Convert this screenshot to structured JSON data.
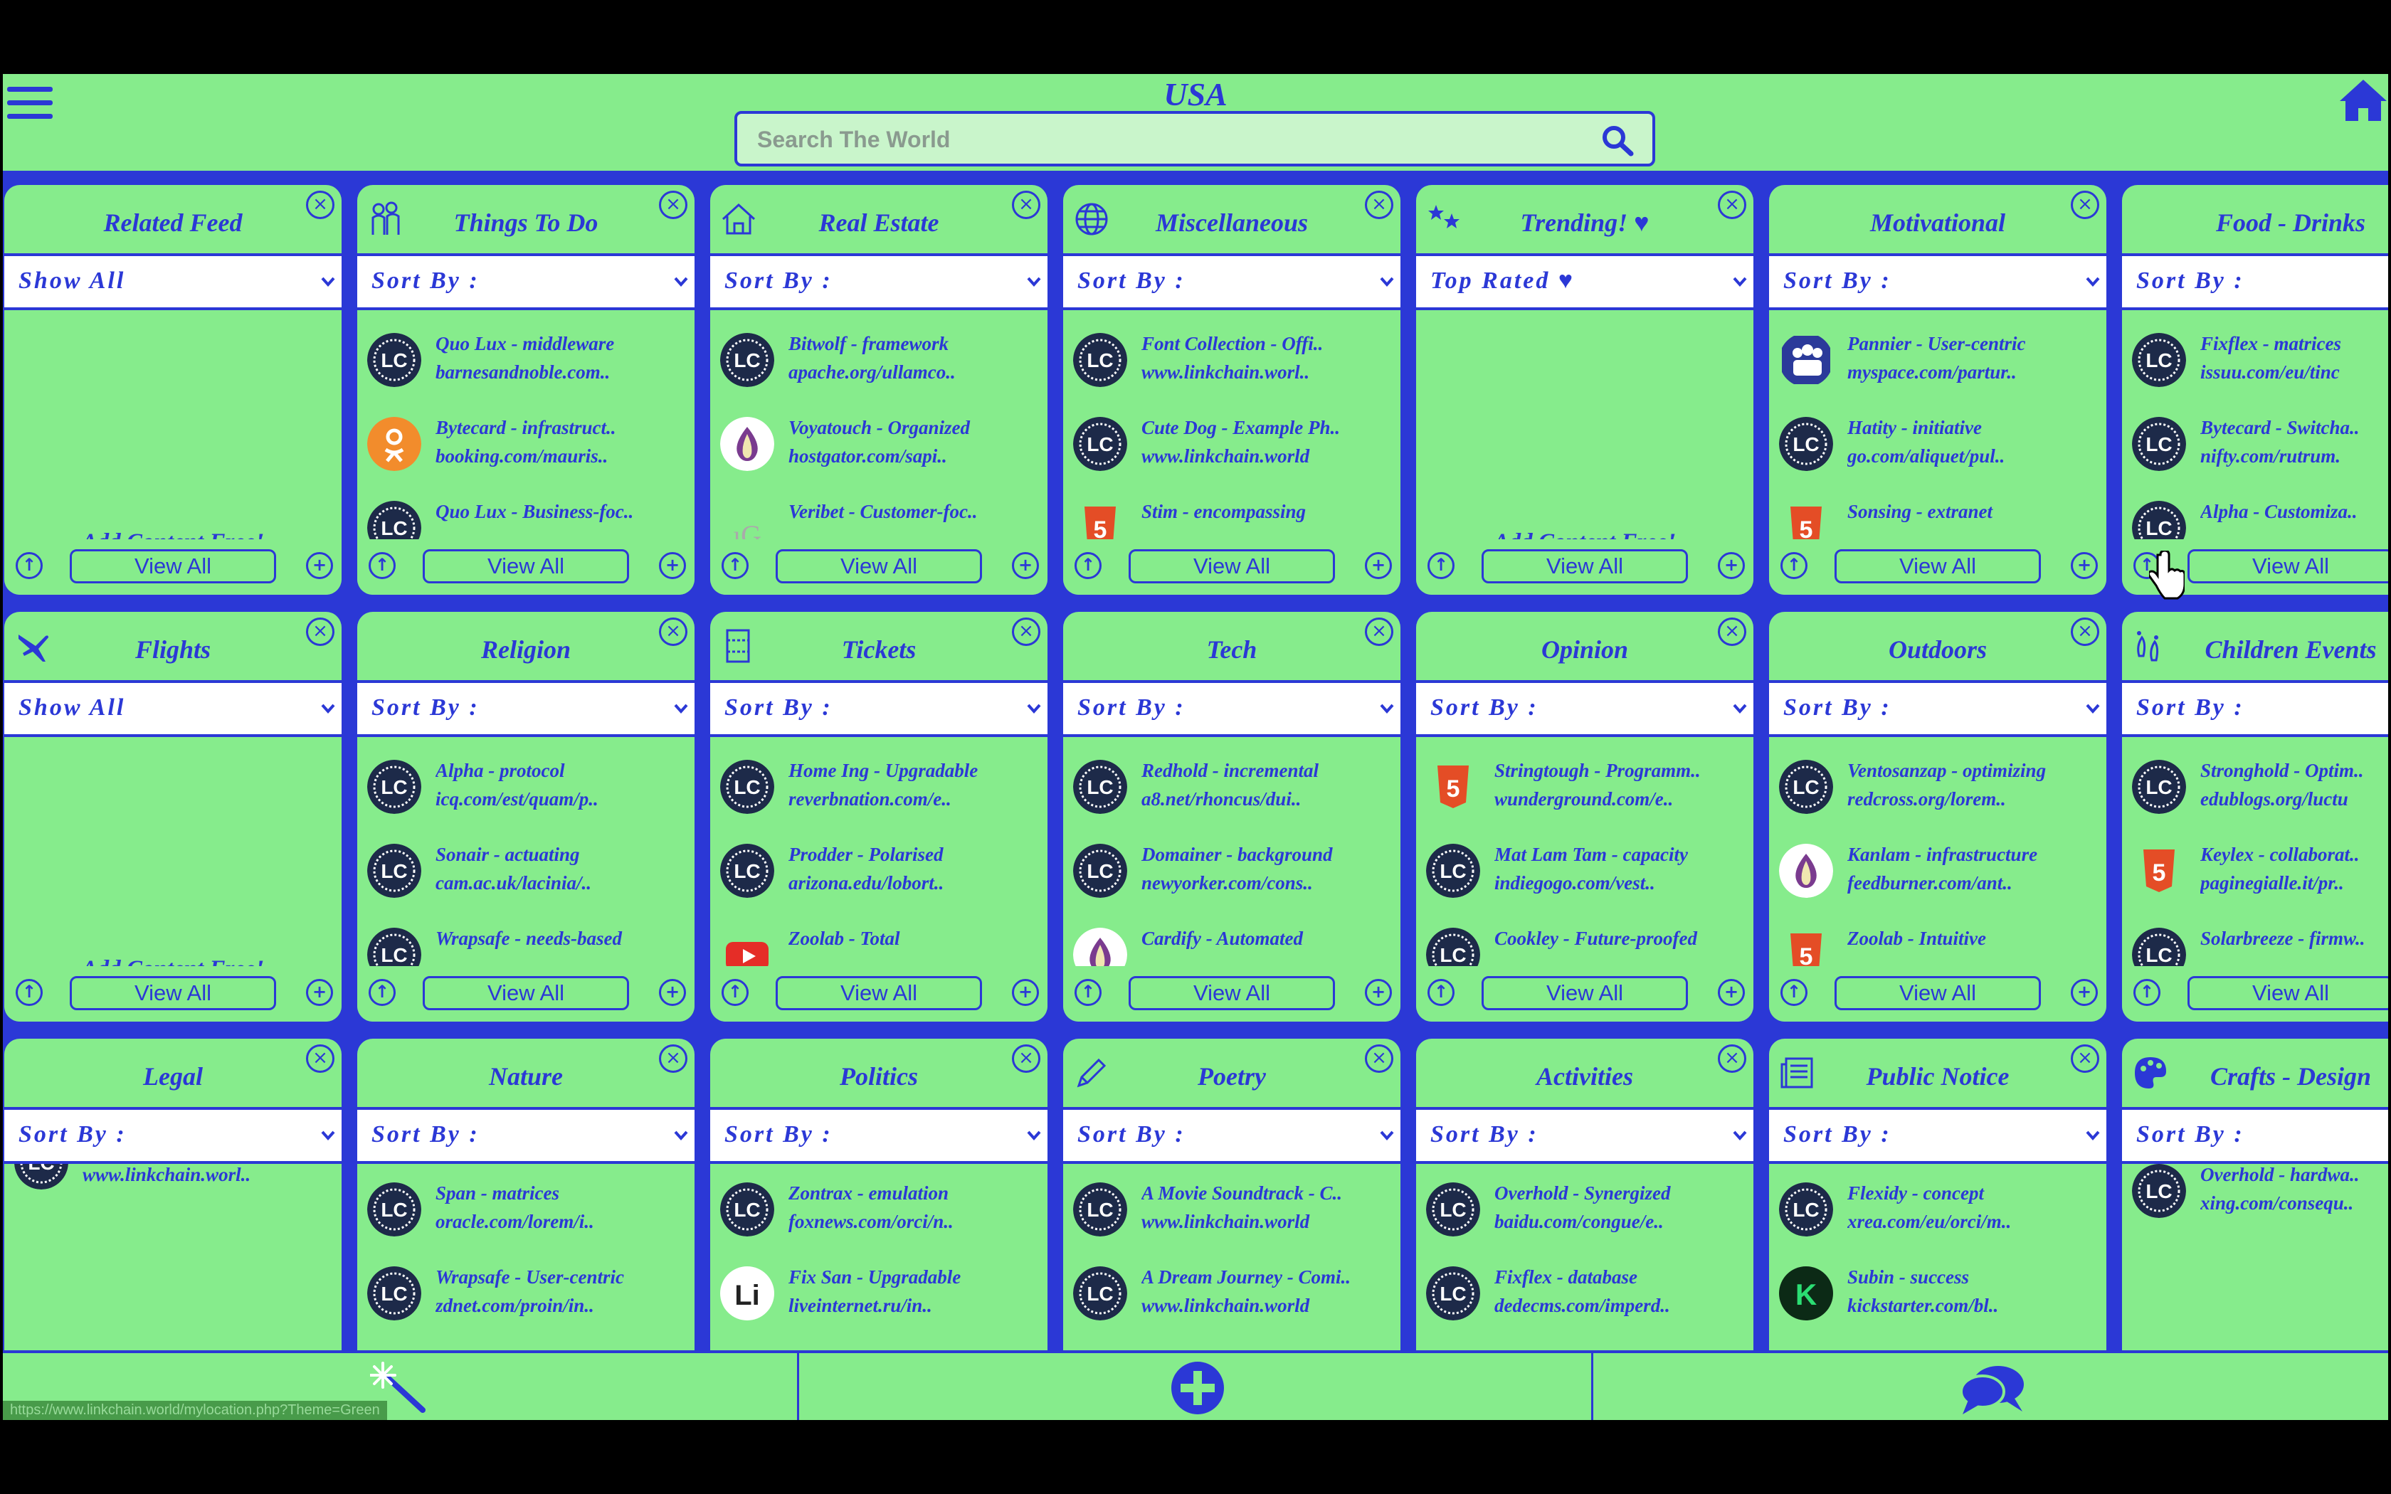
{
  "header": {
    "title": "USA",
    "search_placeholder": "Search The World"
  },
  "footer": {
    "status_url": "https://www.linkchain.world/mylocation.php?Theme=Green"
  },
  "colors": {
    "accent": "#2b38d6",
    "panel": "#86ec8c"
  },
  "cards": [
    {
      "title": "Related Feed",
      "icon": "",
      "sort": "Show All",
      "empty": true,
      "add_content": "Add Content Free!",
      "view_all": "View All",
      "items": []
    },
    {
      "title": "Things To Do",
      "icon": "activities-icon",
      "sort": "Sort By :",
      "view_all": "View All",
      "items": [
        {
          "icon": "lc",
          "title": "Quo Lux - middleware",
          "url": "barnesandnoble.com.."
        },
        {
          "icon": "ok",
          "title": "Bytecard - infrastruct..",
          "url": "booking.com/mauris.."
        },
        {
          "icon": "lc",
          "title": "Quo Lux - Business-foc..",
          "url": ""
        }
      ]
    },
    {
      "title": "Real Estate",
      "icon": "house-icon",
      "sort": "Sort By :",
      "view_all": "View All",
      "items": [
        {
          "icon": "lc",
          "title": "Bitwolf - framework",
          "url": "apache.org/ullamco.."
        },
        {
          "icon": "tor",
          "title": "Voyatouch - Organized",
          "url": "hostgator.com/sapi.."
        },
        {
          "icon": "ig",
          "title": "Veribet - Customer-foc..",
          "url": ""
        }
      ]
    },
    {
      "title": "Miscellaneous",
      "icon": "globe-icon",
      "sort": "Sort By :",
      "view_all": "View All",
      "items": [
        {
          "icon": "lc",
          "title": "Font Collection - Offi..",
          "url": "www.linkchain.worl.."
        },
        {
          "icon": "lc",
          "title": "Cute Dog - Example Ph..",
          "url": "www.linkchain.world"
        },
        {
          "icon": "html5",
          "title": "Stim - encompassing",
          "url": ""
        }
      ]
    },
    {
      "title": "Trending! ♥",
      "icon": "stars-icon",
      "sort": "Top Rated ♥",
      "empty": true,
      "add_content": "Add Content Free!",
      "view_all": "View All",
      "items": []
    },
    {
      "title": "Motivational",
      "icon": "",
      "sort": "Sort By :",
      "view_all": "View All",
      "items": [
        {
          "icon": "myspace",
          "title": "Pannier - User-centric",
          "url": "myspace.com/partur.."
        },
        {
          "icon": "lc",
          "title": "Hatity - initiative",
          "url": "go.com/aliquet/pul.."
        },
        {
          "icon": "html5",
          "title": "Sonsing - extranet",
          "url": ""
        }
      ]
    },
    {
      "title": "Food - Drinks",
      "icon": "",
      "sort": "Sort By :",
      "view_all": "View All",
      "items": [
        {
          "icon": "lc",
          "title": "Fixflex - matrices",
          "url": "issuu.com/eu/tinc"
        },
        {
          "icon": "lc",
          "title": "Bytecard - Switcha..",
          "url": "nifty.com/rutrum."
        },
        {
          "icon": "lc",
          "title": "Alpha - Customiza..",
          "url": ""
        }
      ]
    },
    {
      "title": "Flights",
      "icon": "plane-icon",
      "sort": "Show All",
      "empty": true,
      "add_content": "Add Content Free!",
      "view_all": "View All",
      "items": []
    },
    {
      "title": "Religion",
      "icon": "",
      "sort": "Sort By :",
      "view_all": "View All",
      "items": [
        {
          "icon": "lc",
          "title": "Alpha - protocol",
          "url": "icq.com/est/quam/p.."
        },
        {
          "icon": "lc",
          "title": "Sonair - actuating",
          "url": "cam.ac.uk/lacinia/.."
        },
        {
          "icon": "lc",
          "title": "Wrapsafe - needs-based",
          "url": ""
        }
      ]
    },
    {
      "title": "Tickets",
      "icon": "ticket-icon",
      "sort": "Sort By :",
      "view_all": "View All",
      "items": [
        {
          "icon": "lc",
          "title": "Home Ing - Upgradable",
          "url": "reverbnation.com/e.."
        },
        {
          "icon": "lc",
          "title": "Prodder - Polarised",
          "url": "arizona.edu/lobort.."
        },
        {
          "icon": "youtube",
          "title": "Zoolab - Total",
          "url": ""
        }
      ]
    },
    {
      "title": "Tech",
      "icon": "",
      "sort": "Sort By :",
      "view_all": "View All",
      "items": [
        {
          "icon": "lc",
          "title": "Redhold - incremental",
          "url": "a8.net/rhoncus/dui.."
        },
        {
          "icon": "lc",
          "title": "Domainer - background",
          "url": "newyorker.com/cons.."
        },
        {
          "icon": "tor",
          "title": "Cardify - Automated",
          "url": ""
        }
      ]
    },
    {
      "title": "Opinion",
      "icon": "",
      "sort": "Sort By :",
      "view_all": "View All",
      "items": [
        {
          "icon": "html5",
          "title": "Stringtough - Programm..",
          "url": "wunderground.com/e.."
        },
        {
          "icon": "lc",
          "title": "Mat Lam Tam - capacity",
          "url": "indiegogo.com/vest.."
        },
        {
          "icon": "lc",
          "title": "Cookley - Future-proofed",
          "url": ""
        }
      ]
    },
    {
      "title": "Outdoors",
      "icon": "",
      "sort": "Sort By :",
      "view_all": "View All",
      "items": [
        {
          "icon": "lc",
          "title": "Ventosanzap - optimizing",
          "url": "redcross.org/lorem.."
        },
        {
          "icon": "tor",
          "title": "Kanlam - infrastructure",
          "url": "feedburner.com/ant.."
        },
        {
          "icon": "html5",
          "title": "Zoolab - Intuitive",
          "url": ""
        }
      ]
    },
    {
      "title": "Children Events",
      "icon": "footprints-icon",
      "sort": "Sort By :",
      "view_all": "View All",
      "items": [
        {
          "icon": "lc",
          "title": "Stronghold - Optim..",
          "url": "edublogs.org/luctu"
        },
        {
          "icon": "html5",
          "title": "Keylex - collaborat..",
          "url": "paginegialle.it/pr.."
        },
        {
          "icon": "lc",
          "title": "Solarbreeze - firmw..",
          "url": ""
        }
      ]
    },
    {
      "title": "Legal",
      "icon": "",
      "sort": "Sort By :",
      "view_all": "View All",
      "first_url": "www.linkchain.worl..",
      "items": []
    },
    {
      "title": "Nature",
      "icon": "",
      "sort": "Sort By :",
      "view_all": "View All",
      "items": [
        {
          "icon": "lc",
          "title": "Span - matrices",
          "url": "oracle.com/lorem/i.."
        },
        {
          "icon": "lc",
          "title": "Wrapsafe - User-centric",
          "url": "zdnet.com/proin/in.."
        }
      ]
    },
    {
      "title": "Politics",
      "icon": "",
      "sort": "Sort By :",
      "view_all": "View All",
      "items": [
        {
          "icon": "lc",
          "title": "Zontrax - emulation",
          "url": "foxnews.com/orci/n.."
        },
        {
          "icon": "li",
          "title": "Fix San - Upgradable",
          "url": "liveinternet.ru/in.."
        }
      ]
    },
    {
      "title": "Poetry",
      "icon": "pencil-icon",
      "sort": "Sort By :",
      "view_all": "View All",
      "items": [
        {
          "icon": "lc",
          "title": "A Movie Soundtrack - C..",
          "url": "www.linkchain.world"
        },
        {
          "icon": "lc",
          "title": "A Dream Journey - Comi..",
          "url": "www.linkchain.world"
        }
      ]
    },
    {
      "title": "Activities",
      "icon": "",
      "sort": "Sort By :",
      "view_all": "View All",
      "items": [
        {
          "icon": "lc",
          "title": "Overhold - Synergized",
          "url": "baidu.com/congue/e.."
        },
        {
          "icon": "lc",
          "title": "Fixflex - database",
          "url": "dedecms.com/imperd.."
        }
      ]
    },
    {
      "title": "Public Notice",
      "icon": "newspaper-icon",
      "sort": "Sort By :",
      "view_all": "View All",
      "items": [
        {
          "icon": "lc",
          "title": "Flexidy - concept",
          "url": "xrea.com/eu/orci/m.."
        },
        {
          "icon": "k",
          "title": "Subin - success",
          "url": "kickstarter.com/bl.."
        }
      ]
    },
    {
      "title": "Crafts - Design",
      "icon": "palette-icon",
      "sort": "Sort By :",
      "view_all": "View All",
      "items": [
        {
          "icon": "lc",
          "title": "Overhold - hardwa..",
          "url": "xing.com/consequ.."
        }
      ]
    }
  ]
}
